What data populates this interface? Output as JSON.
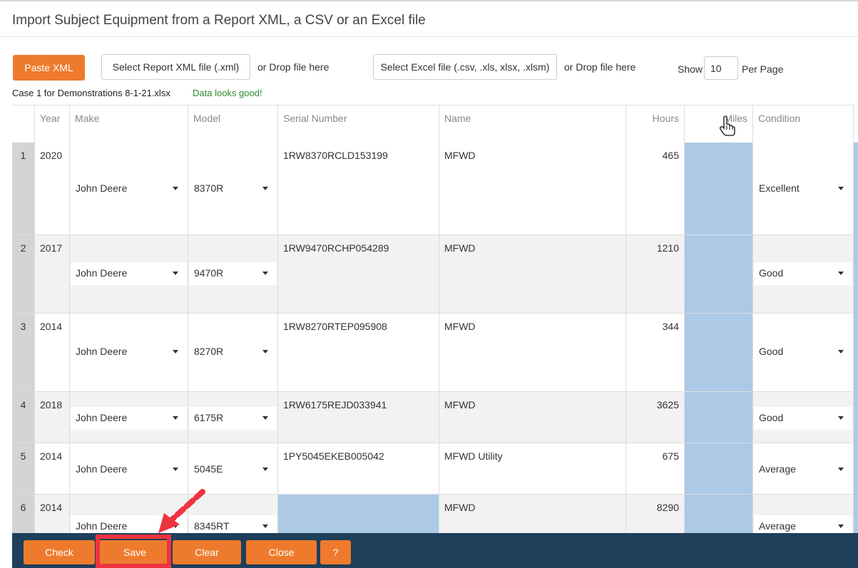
{
  "title": "Import Subject Equipment from a Report XML, a CSV or an Excel file",
  "toolbar": {
    "paste_xml": "Paste XML",
    "select_xml": "Select Report XML file (.xml)",
    "drop_xml": "or Drop file here",
    "select_excel": "Select Excel file (.csv, .xls, xlsx, .xlsm)",
    "drop_excel": "or Drop file here",
    "show_label": "Show",
    "per_page_value": "10",
    "per_page_label": "Per Page"
  },
  "file": {
    "name": "Case 1 for Demonstrations 8-1-21.xlsx",
    "status": "Data looks good!"
  },
  "table": {
    "columns": [
      "Year",
      "Make",
      "Model",
      "Serial Number",
      "Name",
      "Hours",
      "Miles",
      "Condition"
    ],
    "rows": [
      {
        "num": "1",
        "year": "2020",
        "make": "John Deere",
        "model": "8370R",
        "serial": "1RW8370RCLD153199",
        "name": "MFWD",
        "hours": "465",
        "miles": "",
        "condition": "Excellent"
      },
      {
        "num": "2",
        "year": "2017",
        "make": "John Deere",
        "model": "9470R",
        "serial": "1RW9470RCHP054289",
        "name": "MFWD",
        "hours": "1210",
        "miles": "",
        "condition": "Good"
      },
      {
        "num": "3",
        "year": "2014",
        "make": "John Deere",
        "model": "8270R",
        "serial": "1RW8270RTEP095908",
        "name": "MFWD",
        "hours": "344",
        "miles": "",
        "condition": "Good"
      },
      {
        "num": "4",
        "year": "2018",
        "make": "John Deere",
        "model": "6175R",
        "serial": "1RW6175REJD033941",
        "name": "MFWD",
        "hours": "3625",
        "miles": "",
        "condition": "Good"
      },
      {
        "num": "5",
        "year": "2014",
        "make": "John Deere",
        "model": "5045E",
        "serial": "1PY5045EKEB005042",
        "name": "MFWD Utility",
        "hours": "675",
        "miles": "",
        "condition": "Average"
      },
      {
        "num": "6",
        "year": "2014",
        "make": "John Deere",
        "model": "8345RT",
        "serial": "",
        "name": "MFWD",
        "hours": "8290",
        "miles": "",
        "condition": "Average"
      }
    ]
  },
  "footer": {
    "check": "Check",
    "save": "Save",
    "clear": "Clear",
    "close": "Close",
    "help": "?"
  },
  "colors": {
    "accent": "#ee7b2d",
    "footer_bg": "#1e3f5a",
    "empty_cell": "#adc9e6",
    "annotation": "#ee3340",
    "ok_text": "#2b8a2b"
  }
}
